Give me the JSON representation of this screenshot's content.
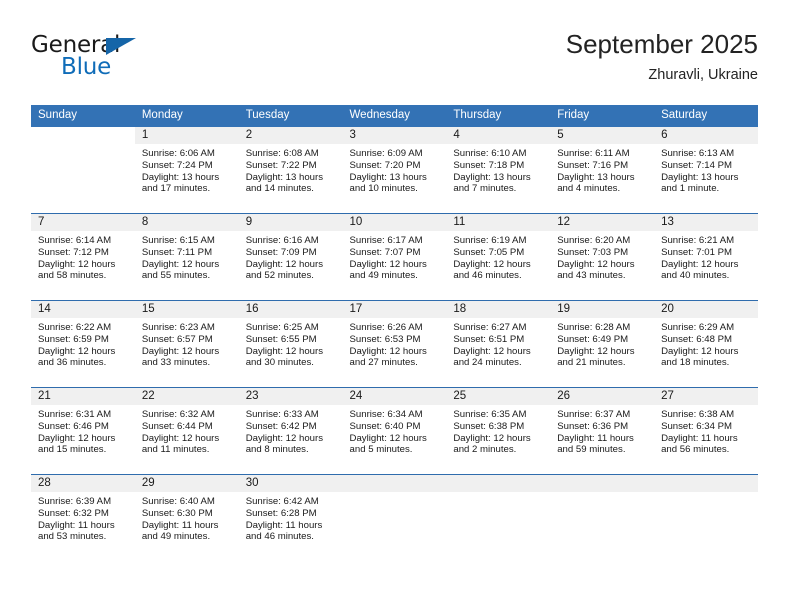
{
  "brand": {
    "line1": "General",
    "line2": "Blue",
    "flag_icon": "triangle-flag-icon",
    "accent_color": "#0f6cb8"
  },
  "header": {
    "title": "September 2025",
    "subtitle": "Zhuravli, Ukraine"
  },
  "theme": {
    "header_bg": "#3372b5",
    "row_divider": "#2f6cad",
    "daynum_band": "#f0f0f0"
  },
  "calendar": {
    "weekday_headers": [
      "Sunday",
      "Monday",
      "Tuesday",
      "Wednesday",
      "Thursday",
      "Friday",
      "Saturday"
    ],
    "weeks": [
      [
        {
          "day": "",
          "sunrise": "",
          "sunset": "",
          "daylight1": "",
          "daylight2": "",
          "state": "none"
        },
        {
          "day": "1",
          "sunrise": "Sunrise: 6:06 AM",
          "sunset": "Sunset: 7:24 PM",
          "daylight1": "Daylight: 13 hours",
          "daylight2": "and 17 minutes.",
          "state": "filled"
        },
        {
          "day": "2",
          "sunrise": "Sunrise: 6:08 AM",
          "sunset": "Sunset: 7:22 PM",
          "daylight1": "Daylight: 13 hours",
          "daylight2": "and 14 minutes.",
          "state": "filled"
        },
        {
          "day": "3",
          "sunrise": "Sunrise: 6:09 AM",
          "sunset": "Sunset: 7:20 PM",
          "daylight1": "Daylight: 13 hours",
          "daylight2": "and 10 minutes.",
          "state": "filled"
        },
        {
          "day": "4",
          "sunrise": "Sunrise: 6:10 AM",
          "sunset": "Sunset: 7:18 PM",
          "daylight1": "Daylight: 13 hours",
          "daylight2": "and 7 minutes.",
          "state": "filled"
        },
        {
          "day": "5",
          "sunrise": "Sunrise: 6:11 AM",
          "sunset": "Sunset: 7:16 PM",
          "daylight1": "Daylight: 13 hours",
          "daylight2": "and 4 minutes.",
          "state": "filled"
        },
        {
          "day": "6",
          "sunrise": "Sunrise: 6:13 AM",
          "sunset": "Sunset: 7:14 PM",
          "daylight1": "Daylight: 13 hours",
          "daylight2": "and 1 minute.",
          "state": "filled"
        }
      ],
      [
        {
          "day": "7",
          "sunrise": "Sunrise: 6:14 AM",
          "sunset": "Sunset: 7:12 PM",
          "daylight1": "Daylight: 12 hours",
          "daylight2": "and 58 minutes.",
          "state": "filled"
        },
        {
          "day": "8",
          "sunrise": "Sunrise: 6:15 AM",
          "sunset": "Sunset: 7:11 PM",
          "daylight1": "Daylight: 12 hours",
          "daylight2": "and 55 minutes.",
          "state": "filled"
        },
        {
          "day": "9",
          "sunrise": "Sunrise: 6:16 AM",
          "sunset": "Sunset: 7:09 PM",
          "daylight1": "Daylight: 12 hours",
          "daylight2": "and 52 minutes.",
          "state": "filled"
        },
        {
          "day": "10",
          "sunrise": "Sunrise: 6:17 AM",
          "sunset": "Sunset: 7:07 PM",
          "daylight1": "Daylight: 12 hours",
          "daylight2": "and 49 minutes.",
          "state": "filled"
        },
        {
          "day": "11",
          "sunrise": "Sunrise: 6:19 AM",
          "sunset": "Sunset: 7:05 PM",
          "daylight1": "Daylight: 12 hours",
          "daylight2": "and 46 minutes.",
          "state": "filled"
        },
        {
          "day": "12",
          "sunrise": "Sunrise: 6:20 AM",
          "sunset": "Sunset: 7:03 PM",
          "daylight1": "Daylight: 12 hours",
          "daylight2": "and 43 minutes.",
          "state": "filled"
        },
        {
          "day": "13",
          "sunrise": "Sunrise: 6:21 AM",
          "sunset": "Sunset: 7:01 PM",
          "daylight1": "Daylight: 12 hours",
          "daylight2": "and 40 minutes.",
          "state": "filled"
        }
      ],
      [
        {
          "day": "14",
          "sunrise": "Sunrise: 6:22 AM",
          "sunset": "Sunset: 6:59 PM",
          "daylight1": "Daylight: 12 hours",
          "daylight2": "and 36 minutes.",
          "state": "filled"
        },
        {
          "day": "15",
          "sunrise": "Sunrise: 6:23 AM",
          "sunset": "Sunset: 6:57 PM",
          "daylight1": "Daylight: 12 hours",
          "daylight2": "and 33 minutes.",
          "state": "filled"
        },
        {
          "day": "16",
          "sunrise": "Sunrise: 6:25 AM",
          "sunset": "Sunset: 6:55 PM",
          "daylight1": "Daylight: 12 hours",
          "daylight2": "and 30 minutes.",
          "state": "filled"
        },
        {
          "day": "17",
          "sunrise": "Sunrise: 6:26 AM",
          "sunset": "Sunset: 6:53 PM",
          "daylight1": "Daylight: 12 hours",
          "daylight2": "and 27 minutes.",
          "state": "filled"
        },
        {
          "day": "18",
          "sunrise": "Sunrise: 6:27 AM",
          "sunset": "Sunset: 6:51 PM",
          "daylight1": "Daylight: 12 hours",
          "daylight2": "and 24 minutes.",
          "state": "filled"
        },
        {
          "day": "19",
          "sunrise": "Sunrise: 6:28 AM",
          "sunset": "Sunset: 6:49 PM",
          "daylight1": "Daylight: 12 hours",
          "daylight2": "and 21 minutes.",
          "state": "filled"
        },
        {
          "day": "20",
          "sunrise": "Sunrise: 6:29 AM",
          "sunset": "Sunset: 6:48 PM",
          "daylight1": "Daylight: 12 hours",
          "daylight2": "and 18 minutes.",
          "state": "filled"
        }
      ],
      [
        {
          "day": "21",
          "sunrise": "Sunrise: 6:31 AM",
          "sunset": "Sunset: 6:46 PM",
          "daylight1": "Daylight: 12 hours",
          "daylight2": "and 15 minutes.",
          "state": "filled"
        },
        {
          "day": "22",
          "sunrise": "Sunrise: 6:32 AM",
          "sunset": "Sunset: 6:44 PM",
          "daylight1": "Daylight: 12 hours",
          "daylight2": "and 11 minutes.",
          "state": "filled"
        },
        {
          "day": "23",
          "sunrise": "Sunrise: 6:33 AM",
          "sunset": "Sunset: 6:42 PM",
          "daylight1": "Daylight: 12 hours",
          "daylight2": "and 8 minutes.",
          "state": "filled"
        },
        {
          "day": "24",
          "sunrise": "Sunrise: 6:34 AM",
          "sunset": "Sunset: 6:40 PM",
          "daylight1": "Daylight: 12 hours",
          "daylight2": "and 5 minutes.",
          "state": "filled"
        },
        {
          "day": "25",
          "sunrise": "Sunrise: 6:35 AM",
          "sunset": "Sunset: 6:38 PM",
          "daylight1": "Daylight: 12 hours",
          "daylight2": "and 2 minutes.",
          "state": "filled"
        },
        {
          "day": "26",
          "sunrise": "Sunrise: 6:37 AM",
          "sunset": "Sunset: 6:36 PM",
          "daylight1": "Daylight: 11 hours",
          "daylight2": "and 59 minutes.",
          "state": "filled"
        },
        {
          "day": "27",
          "sunrise": "Sunrise: 6:38 AM",
          "sunset": "Sunset: 6:34 PM",
          "daylight1": "Daylight: 11 hours",
          "daylight2": "and 56 minutes.",
          "state": "filled"
        }
      ],
      [
        {
          "day": "28",
          "sunrise": "Sunrise: 6:39 AM",
          "sunset": "Sunset: 6:32 PM",
          "daylight1": "Daylight: 11 hours",
          "daylight2": "and 53 minutes.",
          "state": "filled"
        },
        {
          "day": "29",
          "sunrise": "Sunrise: 6:40 AM",
          "sunset": "Sunset: 6:30 PM",
          "daylight1": "Daylight: 11 hours",
          "daylight2": "and 49 minutes.",
          "state": "filled"
        },
        {
          "day": "30",
          "sunrise": "Sunrise: 6:42 AM",
          "sunset": "Sunset: 6:28 PM",
          "daylight1": "Daylight: 11 hours",
          "daylight2": "and 46 minutes.",
          "state": "filled"
        },
        {
          "day": "",
          "sunrise": "",
          "sunset": "",
          "daylight1": "",
          "daylight2": "",
          "state": "blank"
        },
        {
          "day": "",
          "sunrise": "",
          "sunset": "",
          "daylight1": "",
          "daylight2": "",
          "state": "blank"
        },
        {
          "day": "",
          "sunrise": "",
          "sunset": "",
          "daylight1": "",
          "daylight2": "",
          "state": "blank"
        },
        {
          "day": "",
          "sunrise": "",
          "sunset": "",
          "daylight1": "",
          "daylight2": "",
          "state": "blank"
        }
      ]
    ]
  }
}
